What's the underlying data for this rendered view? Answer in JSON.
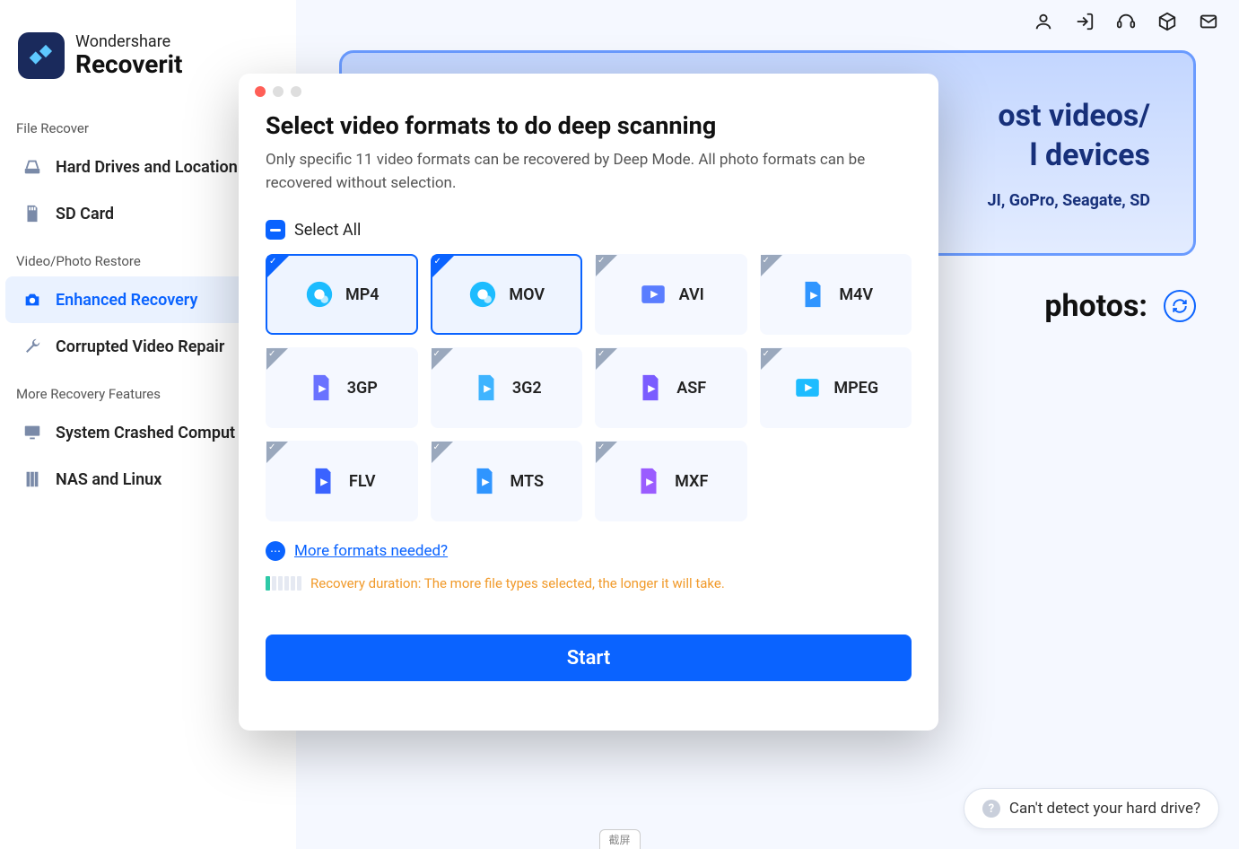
{
  "brand": {
    "line1": "Wondershare",
    "line2": "Recoverit"
  },
  "sidebar": {
    "sections": [
      {
        "header": "File Recover",
        "items": [
          {
            "label": "Hard Drives and Location",
            "icon": "drive"
          },
          {
            "label": "SD Card",
            "icon": "sdcard"
          }
        ]
      },
      {
        "header": "Video/Photo Restore",
        "items": [
          {
            "label": "Enhanced Recovery",
            "icon": "camera",
            "active": true
          },
          {
            "label": "Corrupted Video Repair",
            "icon": "wrench"
          }
        ]
      },
      {
        "header": "More Recovery Features",
        "items": [
          {
            "label": "System Crashed Comput",
            "icon": "monitor"
          },
          {
            "label": "NAS and Linux",
            "icon": "server"
          }
        ]
      }
    ]
  },
  "banner": {
    "title_a": "ost videos/",
    "title_b": "l devices",
    "subtitle": "JI, GoPro, Seagate, SD"
  },
  "photos_label": "photos:",
  "help_pill": "Can't detect your hard drive?",
  "modal": {
    "title": "Select video formats to do deep scanning",
    "subtitle": "Only specific 11 video formats can be recovered by Deep Mode. All photo formats can be recovered without selection.",
    "select_all": "Select All",
    "formats": [
      {
        "label": "MP4",
        "selected": true,
        "color": "#1dbcff"
      },
      {
        "label": "MOV",
        "selected": true,
        "color": "#1dbcff"
      },
      {
        "label": "AVI",
        "selected": false,
        "color": "#5a7dff"
      },
      {
        "label": "M4V",
        "selected": false,
        "color": "#2f95ff"
      },
      {
        "label": "3GP",
        "selected": false,
        "color": "#6a72ff"
      },
      {
        "label": "3G2",
        "selected": false,
        "color": "#3fb4ff"
      },
      {
        "label": "ASF",
        "selected": false,
        "color": "#7a5cff"
      },
      {
        "label": "MPEG",
        "selected": false,
        "color": "#1dbcff"
      },
      {
        "label": "FLV",
        "selected": false,
        "color": "#3a63ff"
      },
      {
        "label": "MTS",
        "selected": false,
        "color": "#2f95ff"
      },
      {
        "label": "MXF",
        "selected": false,
        "color": "#9a5cff"
      }
    ],
    "more_link": "More formats needed?",
    "duration_note": "Recovery duration: The more file types selected, the longer it will take.",
    "start_button": "Start"
  },
  "bottom_tag": "截屏"
}
